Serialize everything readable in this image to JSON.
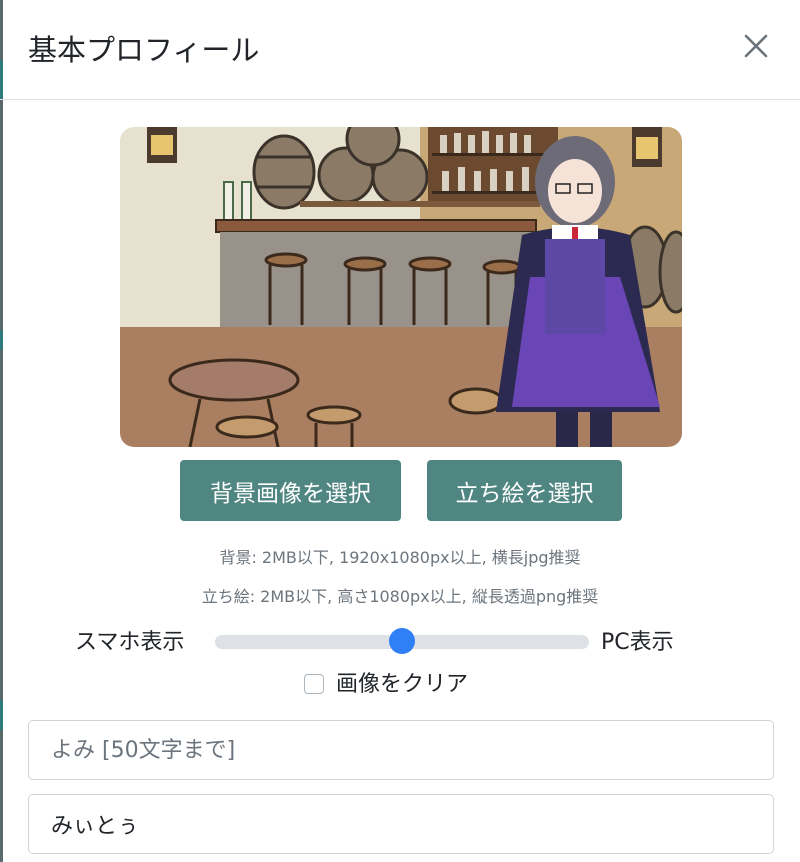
{
  "modal": {
    "title": "基本プロフィール"
  },
  "preview_image": {
    "description_icon": "bar-scene-with-anime-character"
  },
  "buttons": {
    "select_background": "背景画像を選択",
    "select_standing": "立ち絵を選択"
  },
  "notes": {
    "background": "背景: 2MB以下, 1920x1080px以上, 横長jpg推奨",
    "standing": "立ち絵: 2MB以下, 高さ1080px以上, 縦長透過png推奨"
  },
  "slider": {
    "left_label": "スマホ表示",
    "right_label": "PC表示",
    "value_fraction": 0.5
  },
  "clear_image": {
    "label": "画像をクリア",
    "checked": false
  },
  "fields": {
    "yomi": {
      "value": "",
      "placeholder": "よみ [50文字まで]"
    },
    "name": {
      "value": "みぃとぅ",
      "placeholder": ""
    }
  },
  "colors": {
    "button_bg": "#4f8682",
    "slider_thumb": "#2f7ff7",
    "note_text": "#6c757d"
  }
}
